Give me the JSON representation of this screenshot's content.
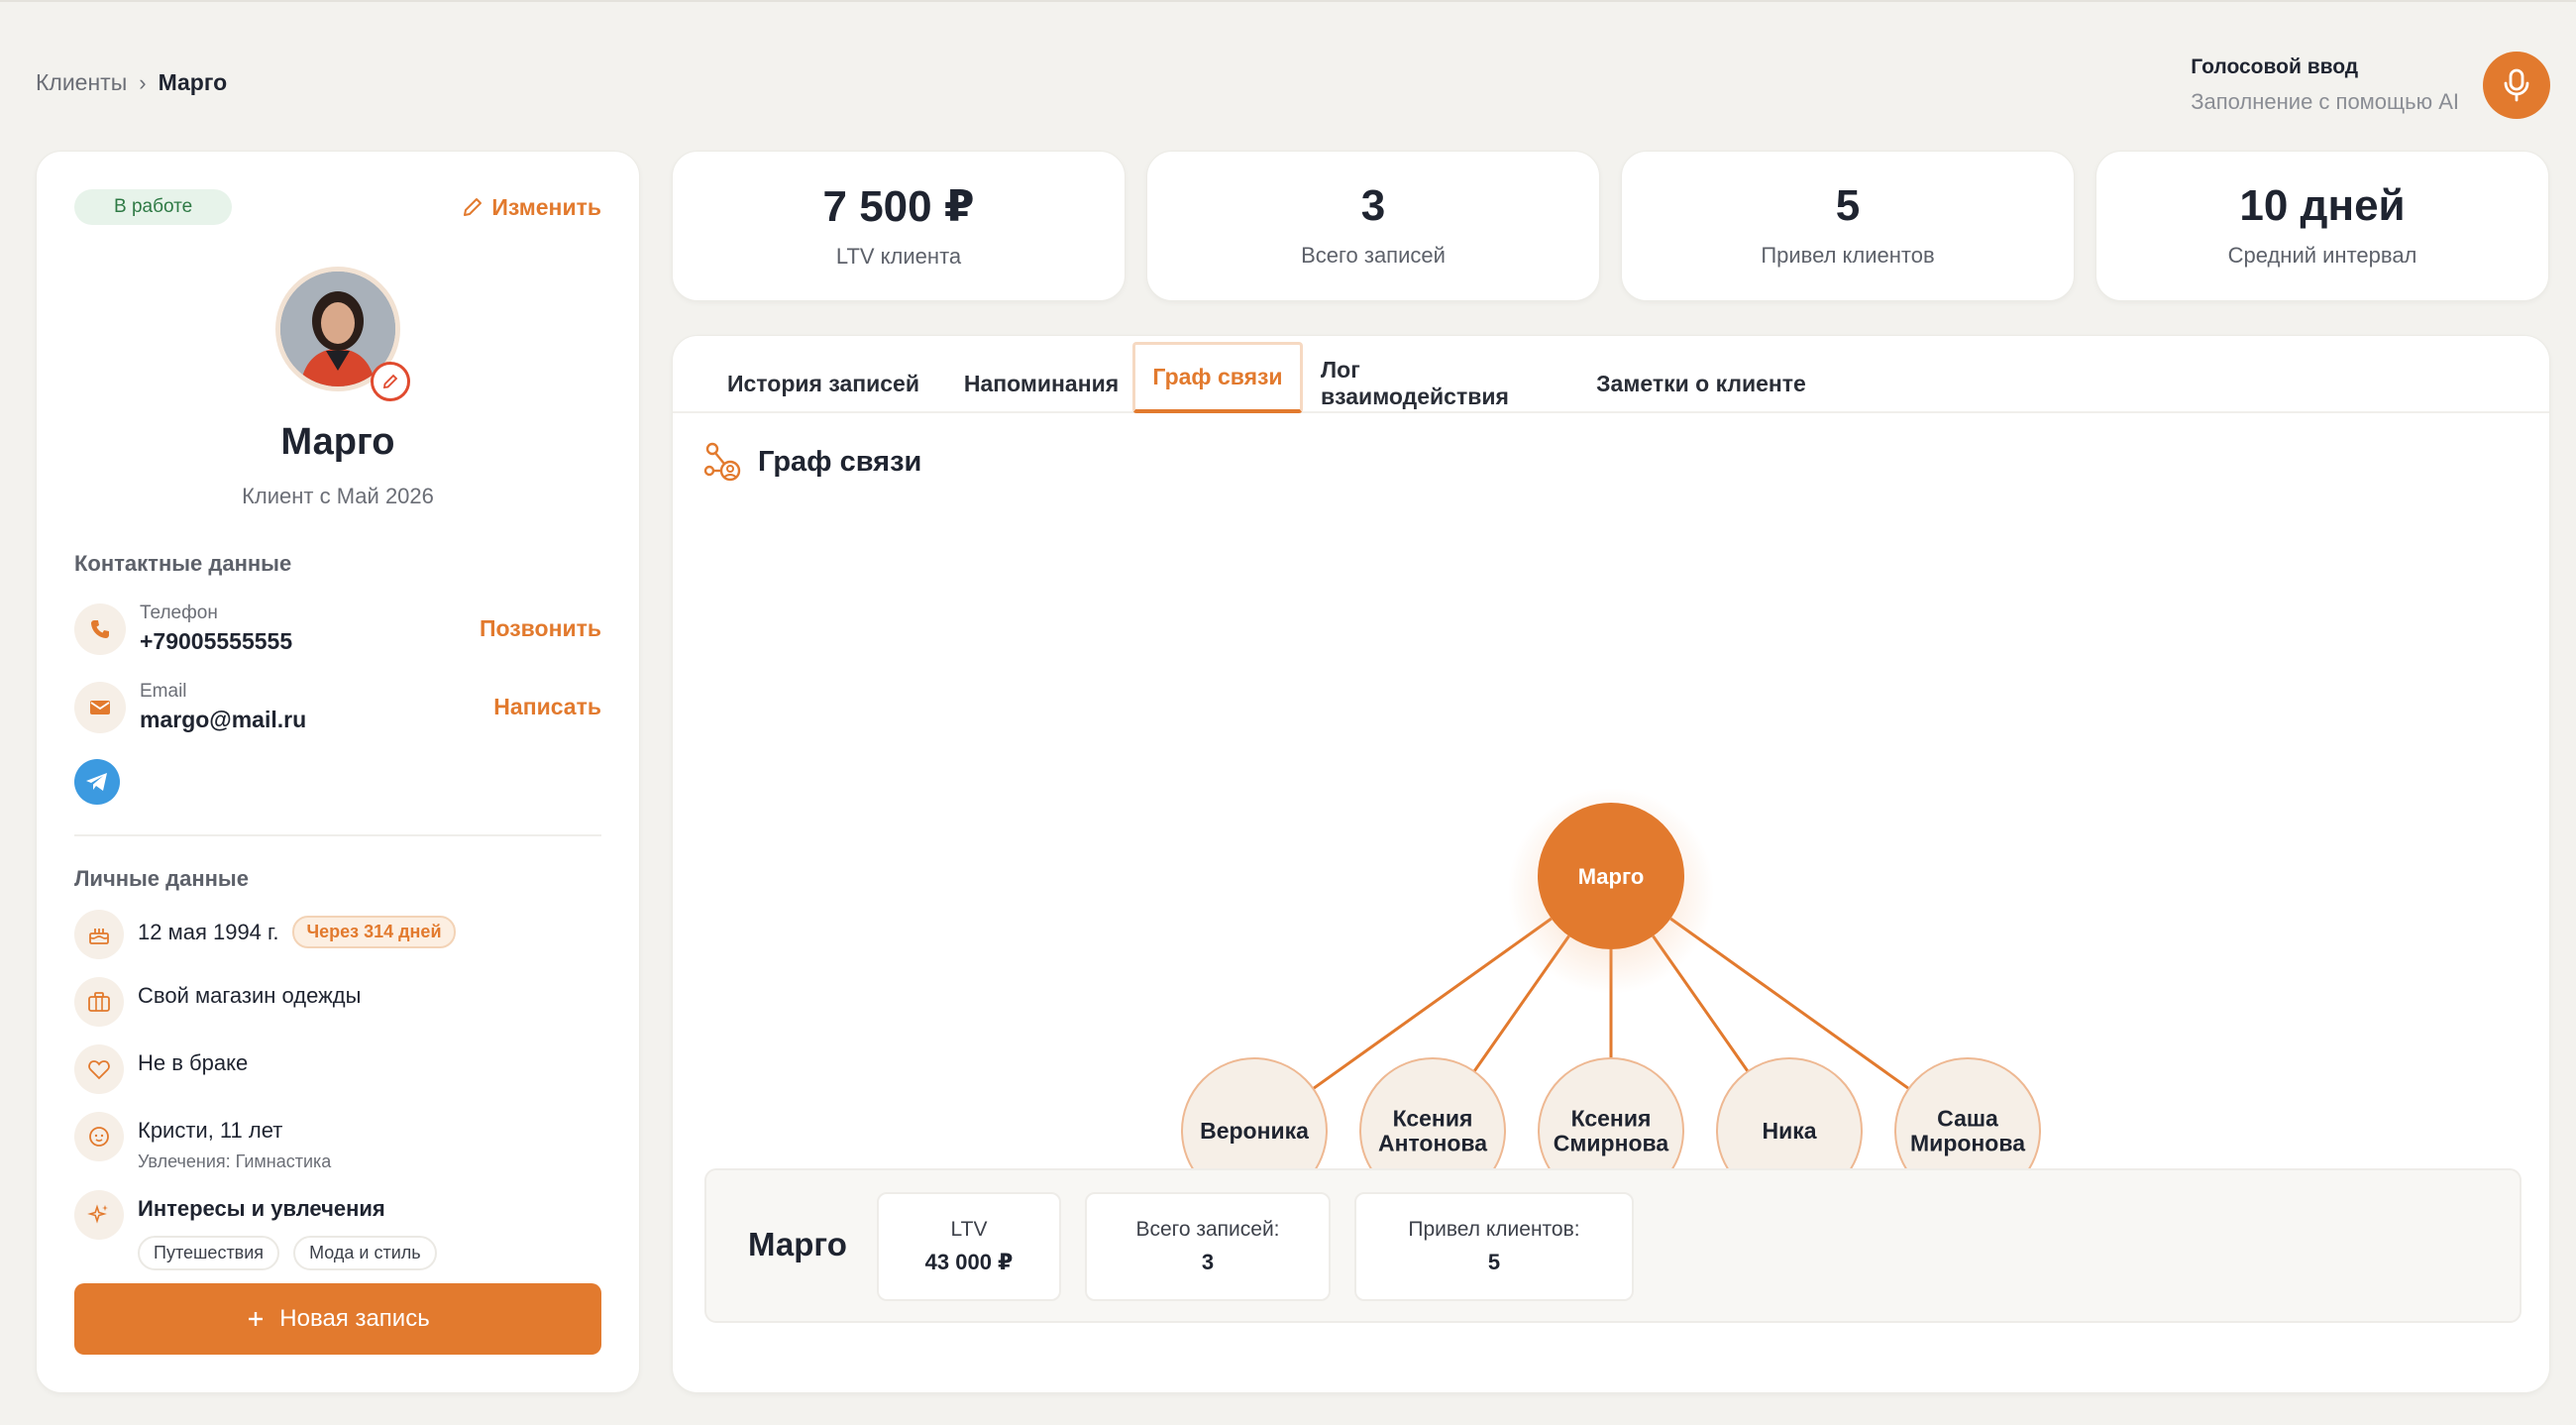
{
  "breadcrumb": {
    "parent": "Клиенты",
    "separator": "›",
    "current": "Марго"
  },
  "voice": {
    "title": "Голосовой ввод",
    "subtitle": "Заполнение с помощью AI",
    "icon": "microphone-icon"
  },
  "profile": {
    "status": "В работе",
    "edit_label": "Изменить",
    "name": "Марго",
    "since": "Клиент с Май 2026",
    "contacts_title": "Контактные данные",
    "phone": {
      "label": "Телефон",
      "value": "+79005555555",
      "action": "Позвонить"
    },
    "email": {
      "label": "Email",
      "value": "margo@mail.ru",
      "action": "Написать"
    },
    "personal_title": "Личные данные",
    "birthday": {
      "value": "12 мая 1994 г.",
      "badge": "Через 314 дней"
    },
    "work": "Свой магазин одежды",
    "marital": "Не в браке",
    "child": {
      "value": "Кристи, 11 лет",
      "sub": "Увлечения: Гимнастика"
    },
    "interests": {
      "title": "Интересы и увлечения",
      "tags": [
        "Путешествия",
        "Мода и стиль"
      ]
    },
    "new_record": "Новая запись"
  },
  "stats": [
    {
      "value": "7 500 ₽",
      "label": "LTV клиента"
    },
    {
      "value": "3",
      "label": "Всего записей"
    },
    {
      "value": "5",
      "label": "Привел клиентов"
    },
    {
      "value": "10 дней",
      "label": "Средний интервал"
    }
  ],
  "tabs": [
    "История записей",
    "Напоминания",
    "Граф связи",
    "Лог взаимодействия",
    "Заметки о клиенте"
  ],
  "active_tab": "Граф связи",
  "graph": {
    "title": "Граф связи",
    "root": "Марго",
    "children": [
      [
        "Вероника"
      ],
      [
        "Ксения",
        "Антонова"
      ],
      [
        "Ксения",
        "Смирнова"
      ],
      [
        "Ника"
      ],
      [
        "Саша",
        "Миронова"
      ]
    ]
  },
  "summary": {
    "name": "Марго",
    "ltv_label": "LTV",
    "ltv_value": "43 000 ₽",
    "records_label": "Всего записей:",
    "records_value": "3",
    "referred_label": "Привел клиентов:",
    "referred_value": "5"
  },
  "colors": {
    "accent": "#e27a2e",
    "background": "#f3f2ee",
    "status_green": "#2f7a45",
    "telegram": "#3c9ae0"
  }
}
